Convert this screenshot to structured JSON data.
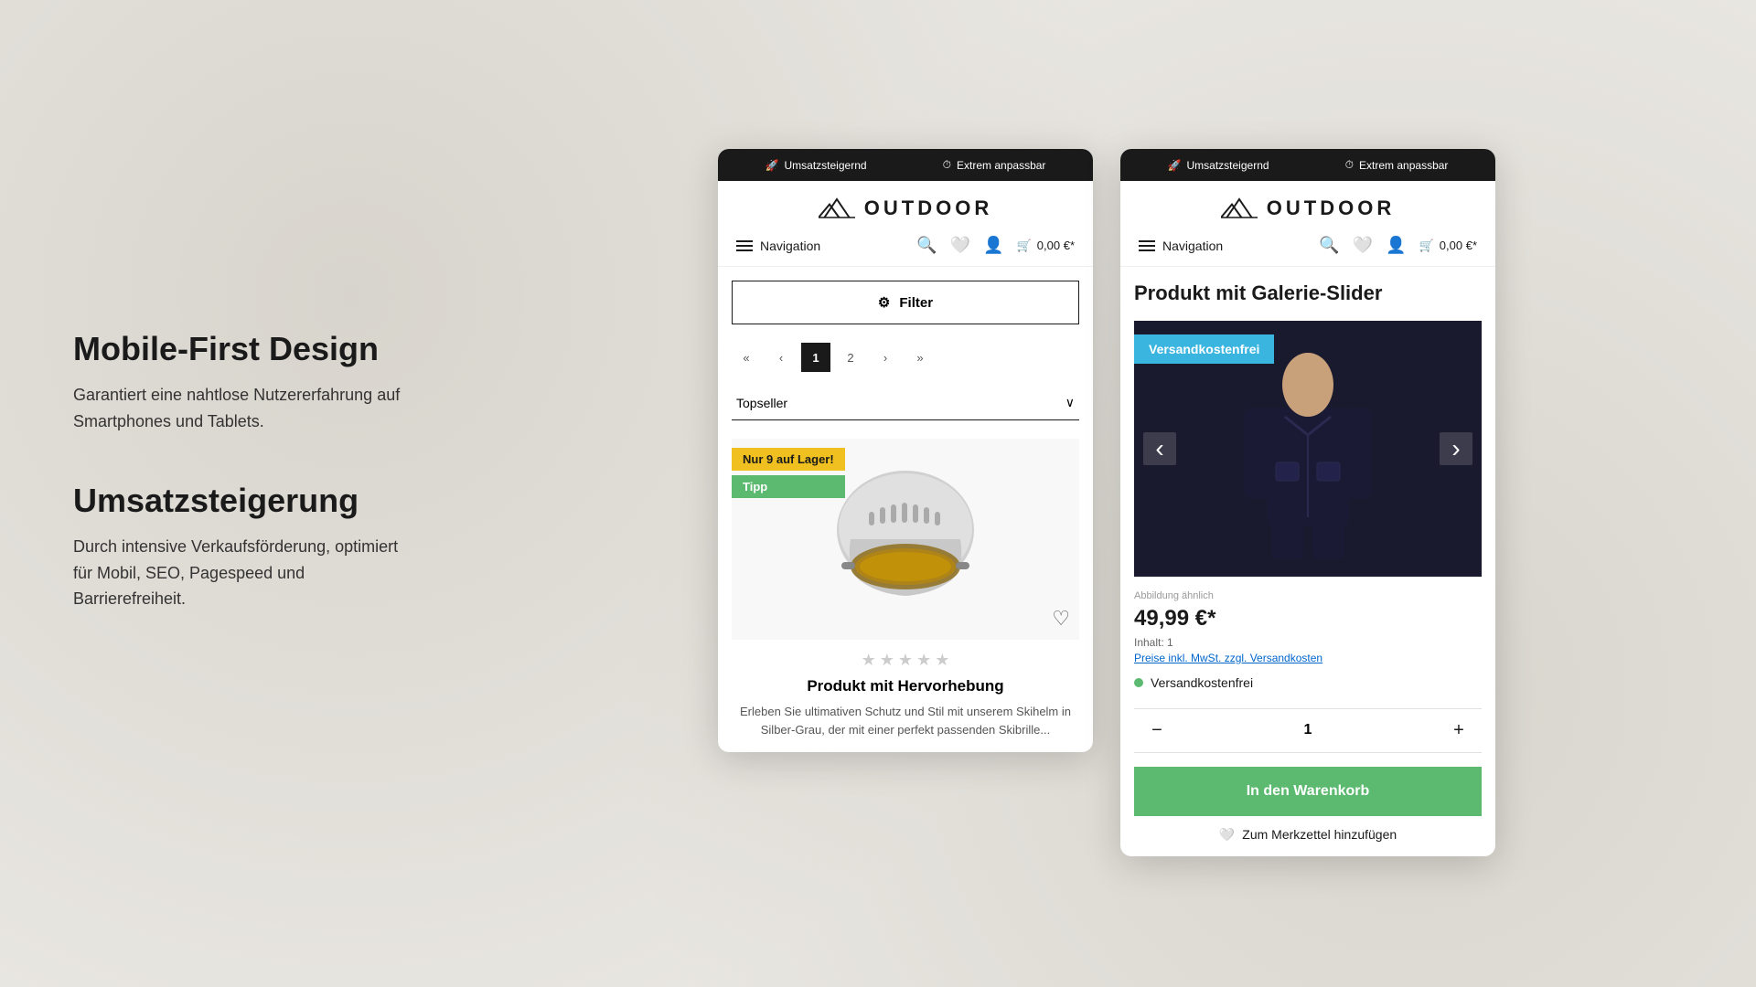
{
  "left": {
    "section1": {
      "title": "Mobile-First Design",
      "description": "Garantiert eine nahtlose Nutzererfahrung auf Smartphones und Tablets."
    },
    "section2": {
      "title": "Umsatzsteigerung",
      "description": "Durch intensive Verkaufsförderung, optimiert für Mobil, SEO, Pagespeed und Barrierefreiheit."
    }
  },
  "phone1": {
    "topbar": {
      "item1": "Umsatzsteigernd",
      "item2": "Extrem anpassbar"
    },
    "logo": "OUTDOOR",
    "nav": "Navigation",
    "cart": "0,00 €*",
    "filter": "Filter",
    "sort": "Topseller",
    "pagination": [
      "«",
      "‹",
      "1",
      "2",
      "›",
      "»"
    ],
    "badges": {
      "badge1": "Nur 9 auf Lager!",
      "badge2": "Tipp"
    },
    "product": {
      "title": "Produkt mit Hervorhebung",
      "description": "Erleben Sie ultimativen Schutz und Stil mit unserem Skihelm in Silber-Grau, der mit einer perfekt passenden Skibrille..."
    }
  },
  "phone2": {
    "topbar": {
      "item1": "Umsatzsteigernd",
      "item2": "Extrem anpassbar"
    },
    "logo": "OUTDOOR",
    "nav": "Navigation",
    "cart": "0,00 €*",
    "product": {
      "title": "Produkt mit Galerie-Slider",
      "free_shipping_badge": "Versandkostenfrei",
      "figure_note": "Abbildung ähnlich",
      "price": "49,99 €*",
      "inhalt": "Inhalt: 1",
      "tax_link": "Preise inkl. MwSt. zzgl. Versandkosten",
      "free_ship_label": "Versandkostenfrei",
      "quantity": "1",
      "add_to_cart": "In den Warenkorb",
      "wishlist_link": "Zum Merkzettel hinzufügen"
    }
  }
}
